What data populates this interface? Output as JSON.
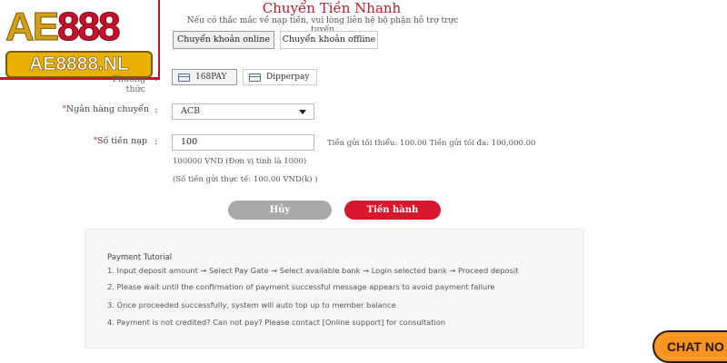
{
  "logo": {
    "brand_part1": "AE",
    "brand_part2": "888",
    "domain": "AE8888.NL"
  },
  "header": {
    "title": "Chuyển Tiền Nhanh",
    "notice": "Nếu có thắc mắc về nạp tiền, vui lòng liên hệ bộ phận hỗ trợ trực tuyến"
  },
  "tabs": [
    {
      "label": "Chuyển khoản online",
      "active": true
    },
    {
      "label": "Chuyển khoản offline",
      "active": false
    }
  ],
  "form": {
    "payment_method_label": "Phương thức",
    "payment_methods": [
      {
        "label": "168PAY",
        "active": true
      },
      {
        "label": "Dipperpay",
        "active": false
      }
    ],
    "bank_label": "Ngân hàng chuyển",
    "bank_selected": "ACB",
    "amount_label": "Số tiền nạp",
    "amount_value": "100",
    "amount_limits": "Tiền gửi tối thiểu: 100.00 Tiền gửi tối đa: 100,000.00",
    "unit_note": "100000 VND (Đơn vị tính là 1000)",
    "actual_note": "(Số tiền gửi thực tế: 100.00 VND(k) )",
    "colon": ":"
  },
  "buttons": {
    "cancel": "Hủy",
    "proceed": "Tiến hành"
  },
  "tutorial": {
    "title": "Payment Tutorial",
    "steps": [
      "1. Input deposit amount → Select Pay Gate → Select available bank → Login selected bank → Proceed deposit",
      "2. Please wait until the confirmation of payment successful message appears to avoid payment failure",
      "3. Once proceeded successfully, system will auto top up to member balance",
      "4. Payment is not credited? Can not pay? Please contact [Online support] for consultation"
    ]
  },
  "chat": {
    "label": "CHAT NO"
  },
  "colors": {
    "accent": "#d9172c",
    "title": "#b8202e",
    "cancel": "#a9a9a9",
    "chat": "#f7931e"
  }
}
